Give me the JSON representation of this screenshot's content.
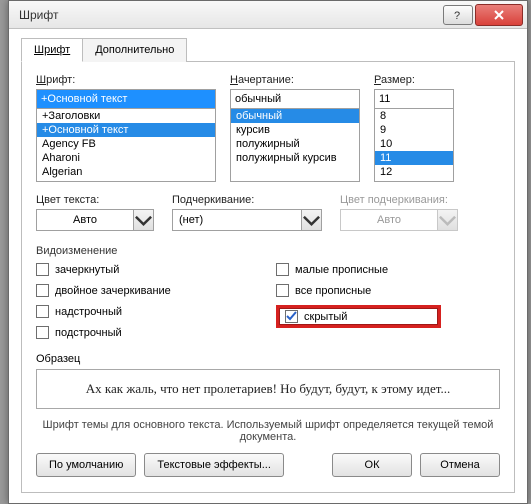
{
  "window": {
    "title": "Шрифт"
  },
  "tabs": {
    "font": "Шрифт",
    "advanced": "Дополнительно"
  },
  "font": {
    "label": "Шрифт:",
    "value": "+Основной текст",
    "options": [
      "+Заголовки",
      "+Основной текст",
      "Agency FB",
      "Aharoni",
      "Algerian"
    ],
    "selected": "+Основной текст"
  },
  "style": {
    "label": "Начертание:",
    "value": "обычный",
    "options": [
      "обычный",
      "курсив",
      "полужирный",
      "полужирный курсив"
    ],
    "selected": "обычный"
  },
  "size": {
    "label": "Размер:",
    "value": "11",
    "options": [
      "8",
      "9",
      "10",
      "11",
      "12"
    ],
    "selected": "11"
  },
  "color": {
    "label": "Цвет текста:",
    "value": "Авто"
  },
  "underline": {
    "label": "Подчеркивание:",
    "value": "(нет)"
  },
  "ulcolor": {
    "label": "Цвет подчеркивания:",
    "value": "Авто"
  },
  "effects": {
    "group_label": "Видоизменение",
    "strike": "зачеркнутый",
    "dstrike": "двойное зачеркивание",
    "superscript": "надстрочный",
    "subscript": "подстрочный",
    "smallcaps": "малые прописные",
    "allcaps": "все прописные",
    "hidden": "скрытый"
  },
  "preview": {
    "label": "Образец",
    "text": "Ах как жаль, что нет пролетариев! Но будут, будут, к этому идет..."
  },
  "theme_note": "Шрифт темы для основного текста. Используемый шрифт определяется текущей темой документа.",
  "buttons": {
    "default": "По умолчанию",
    "text_effects": "Текстовые эффекты...",
    "ok": "ОК",
    "cancel": "Отмена"
  }
}
